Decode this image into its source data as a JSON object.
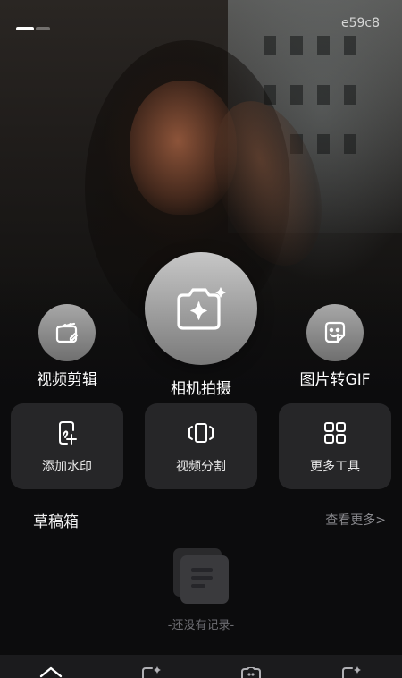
{
  "status": {
    "tag": "e59c8"
  },
  "tools": {
    "video_edit": "视频剪辑",
    "camera": "相机拍摄",
    "image_to_gif": "图片转GIF"
  },
  "cards": {
    "watermark": "添加水印",
    "video_split": "视频分割",
    "more_tools": "更多工具"
  },
  "drafts": {
    "title": "草稿箱",
    "view_more": "查看更多>",
    "empty": "-还没有记录-"
  },
  "colors": {
    "background": "#0c0c0d",
    "card": "#262628",
    "tab_bar": "#1b1b1d",
    "muted_text": "#8a8a8e"
  },
  "icons": [
    "clapper-edit-icon",
    "camera-sparkle-icon",
    "sticker-smile-icon",
    "hand-edit-icon",
    "video-split-icon",
    "grid-apps-icon",
    "document-stack-icon",
    "home-icon",
    "image-sparkle-icon",
    "camera-heart-icon",
    "sticker-sparkle-icon"
  ]
}
